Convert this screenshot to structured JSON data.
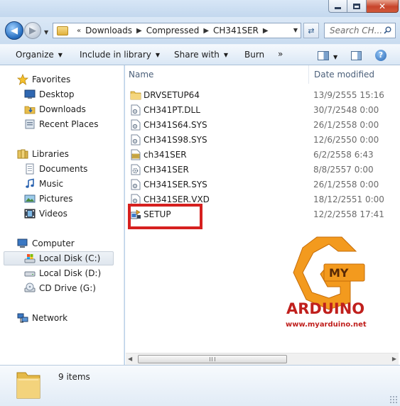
{
  "window": {
    "minimize_icon": "minimize-icon",
    "maximize_icon": "maximize-icon",
    "close_glyph": "✕"
  },
  "address": {
    "overflow": "«",
    "crumbs": [
      "Downloads",
      "Compressed",
      "CH341SER"
    ]
  },
  "search": {
    "placeholder": "Search CH..."
  },
  "toolbar": {
    "organize": "Organize",
    "include_in_library": "Include in library",
    "share_with": "Share with",
    "burn": "Burn",
    "more": "»"
  },
  "nav": {
    "favorites": {
      "label": "Favorites",
      "items": [
        "Desktop",
        "Downloads",
        "Recent Places"
      ]
    },
    "libraries": {
      "label": "Libraries",
      "items": [
        "Documents",
        "Music",
        "Pictures",
        "Videos"
      ]
    },
    "computer": {
      "label": "Computer",
      "items": [
        "Local Disk (C:)",
        "Local Disk (D:)",
        "CD Drive (G:)"
      ],
      "selected": "Local Disk (C:)"
    },
    "network": {
      "label": "Network"
    }
  },
  "files": {
    "columns": {
      "name": "Name",
      "date": "Date modified"
    },
    "rows": [
      {
        "name": "DRVSETUP64",
        "date": "13/9/2555 15:16",
        "icon": "folder-icon"
      },
      {
        "name": "CH341PT.DLL",
        "date": "30/7/2548 0:00",
        "icon": "dll-file-icon"
      },
      {
        "name": "CH341S64.SYS",
        "date": "26/1/2558 0:00",
        "icon": "sys-file-icon"
      },
      {
        "name": "CH341S98.SYS",
        "date": "12/6/2550 0:00",
        "icon": "sys-file-icon"
      },
      {
        "name": "ch341SER",
        "date": "6/2/2558 6:43",
        "icon": "catalog-file-icon"
      },
      {
        "name": "CH341SER",
        "date": "8/8/2557 0:00",
        "icon": "settings-file-icon"
      },
      {
        "name": "CH341SER.SYS",
        "date": "26/1/2558 0:00",
        "icon": "sys-file-icon"
      },
      {
        "name": "CH341SER.VXD",
        "date": "18/12/2551 0:00",
        "icon": "sys-file-icon"
      },
      {
        "name": "SETUP",
        "date": "12/2/2558 17:41",
        "icon": "setup-exe-icon"
      }
    ]
  },
  "watermark": {
    "logo_text": "MY",
    "brand": "ARDUINO",
    "url": "www.myarduino.net",
    "colors": {
      "orange": "#f39a1e",
      "red": "#c0201d"
    }
  },
  "details": {
    "count": "9 items"
  }
}
